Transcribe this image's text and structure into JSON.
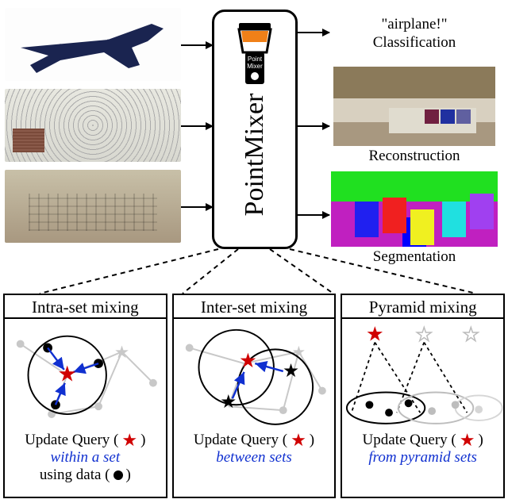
{
  "center": {
    "title": "PointMixer",
    "icon_label": "Point Mixer"
  },
  "inputs": [
    {
      "name": "airplane-pointcloud"
    },
    {
      "name": "sparse-room-pointcloud"
    },
    {
      "name": "dense-room-pointcloud"
    }
  ],
  "outputs": {
    "classification": {
      "quoted": "\"airplane!\"",
      "label": "Classification"
    },
    "reconstruction": {
      "label": "Reconstruction"
    },
    "segmentation": {
      "label": "Segmentation"
    }
  },
  "mixing": [
    {
      "title": "Intra-set mixing",
      "query": "Update Query (",
      "query_close": ")",
      "sub1": "within a set",
      "using": "using data (",
      "using_close": ")"
    },
    {
      "title": "Inter-set mixing",
      "query": "Update Query (",
      "query_close": ")",
      "sub1": "between sets"
    },
    {
      "title": "Pyramid mixing",
      "query": "Update Query (",
      "query_close": ")",
      "sub1": "from pyramid sets"
    }
  ],
  "colors": {
    "accent_red": "#d00000",
    "accent_blue": "#1030d0",
    "airplane_fill": "#1a2450"
  }
}
